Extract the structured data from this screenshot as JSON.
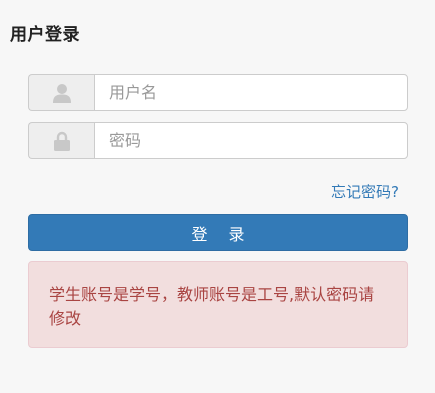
{
  "page": {
    "title": "用户登录"
  },
  "form": {
    "username_placeholder": "用户名",
    "username_icon": "user-icon",
    "password_placeholder": "密码",
    "password_icon": "lock-icon",
    "forgot_link": "忘记密码?",
    "login_button": "登 录"
  },
  "notice": {
    "text": "学生账号是学号，教师账号是工号,默认密码请修改"
  },
  "colors": {
    "primary": "#337ab7",
    "alert_background": "#f2dede",
    "alert_text": "#a94442"
  }
}
